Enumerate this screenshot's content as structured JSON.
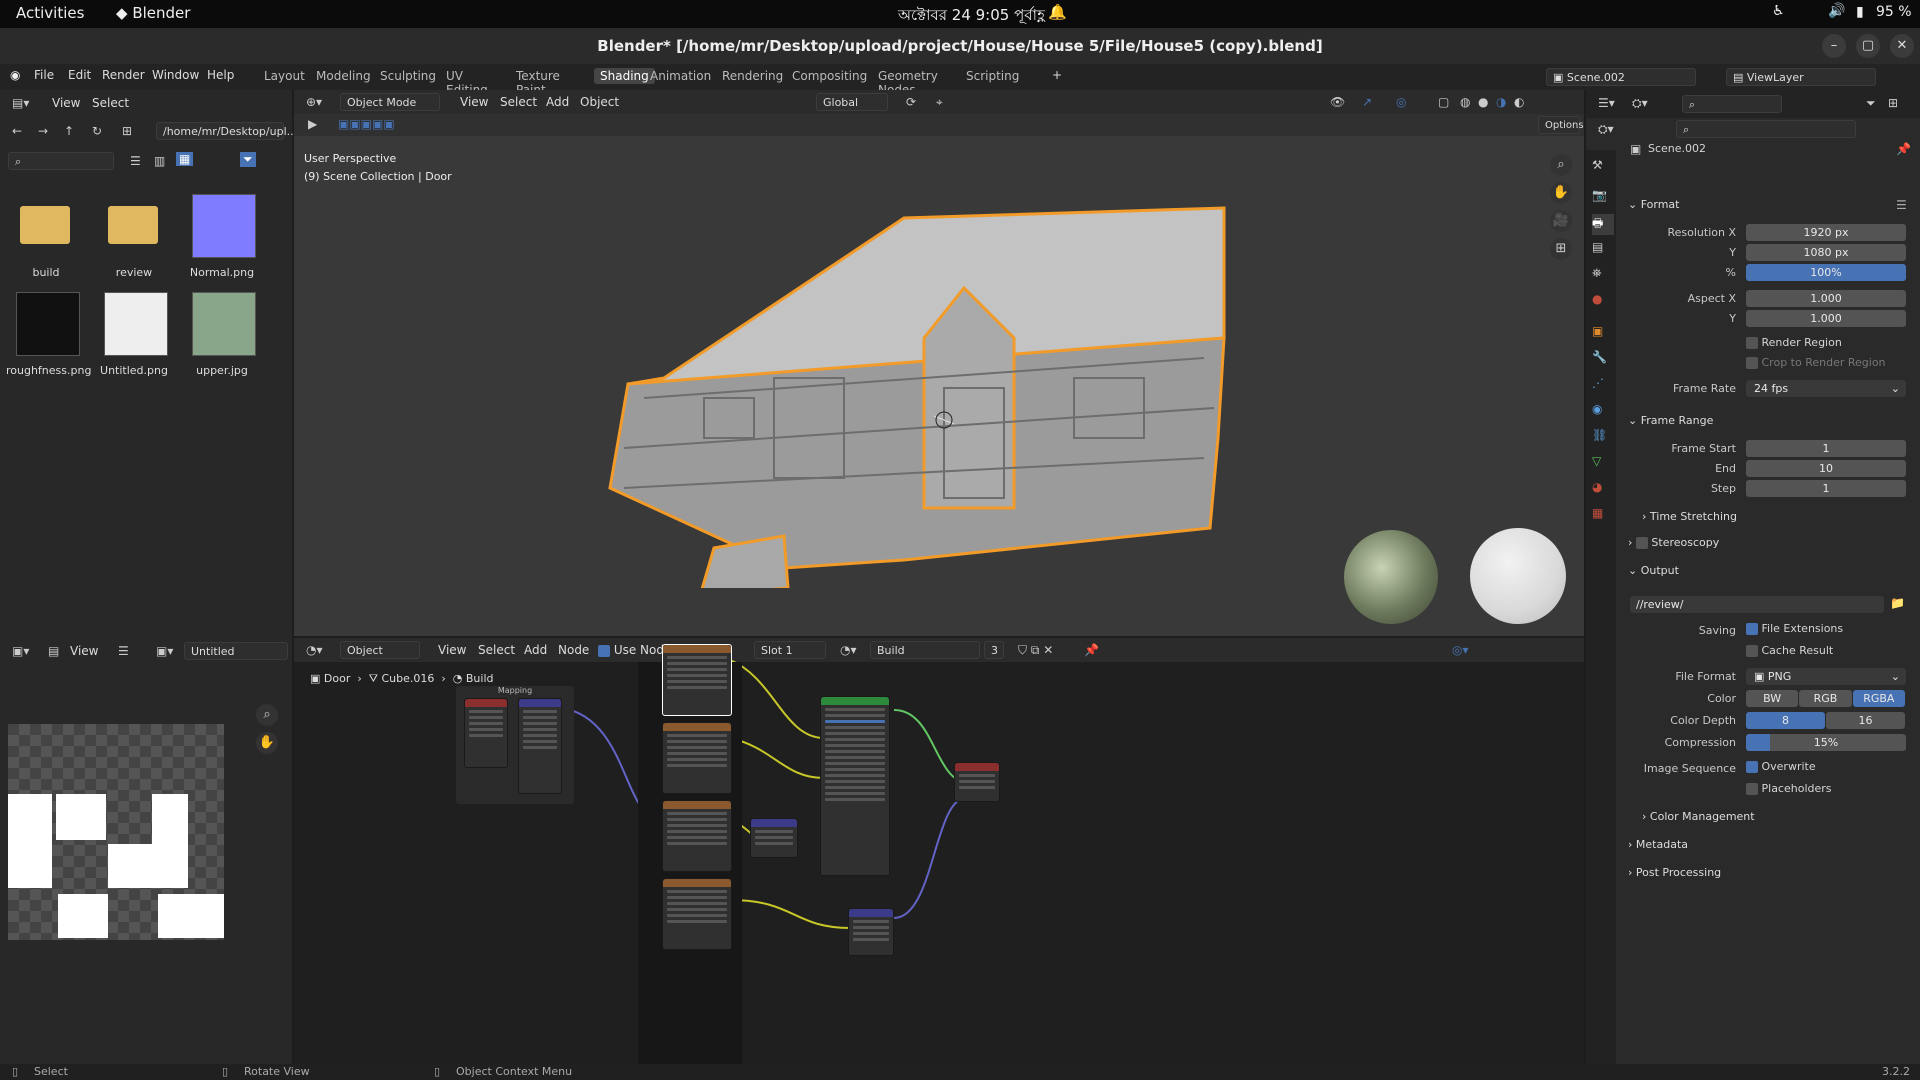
{
  "system_bar": {
    "activities": "Activities",
    "app": "Blender",
    "clock": "অক্টোবর 24  9:05 পূর্বাহ্ণ",
    "battery": "95 %"
  },
  "window": {
    "title": "Blender* [/home/mr/Desktop/upload/project/House/House 5/File/House5 (copy).blend]"
  },
  "menu": {
    "file": "File",
    "edit": "Edit",
    "render": "Render",
    "window": "Window",
    "help": "Help"
  },
  "workspaces": [
    "Layout",
    "Modeling",
    "Sculpting",
    "UV Editing",
    "Texture Paint",
    "Shading",
    "Animation",
    "Rendering",
    "Compositing",
    "Geometry Nodes",
    "Scripting"
  ],
  "active_workspace": "Shading",
  "scene_selector": "Scene.002",
  "view_layer": "ViewLayer",
  "file_browser": {
    "view": "View",
    "select": "Select",
    "path": "/home/mr/Desktop/upl...",
    "items": [
      {
        "name": "build",
        "kind": "folder"
      },
      {
        "name": "review",
        "kind": "folder"
      },
      {
        "name": "Normal.png",
        "kind": "image",
        "color": "#7f7cff"
      },
      {
        "name": "roughfness.png",
        "kind": "image",
        "color": "#111111"
      },
      {
        "name": "Untitled.png",
        "kind": "image",
        "color": "#eeeeee"
      },
      {
        "name": "upper.jpg",
        "kind": "image",
        "color": "#8aa68a"
      }
    ]
  },
  "viewport": {
    "mode": "Object Mode",
    "view": "View",
    "select": "Select",
    "add": "Add",
    "object": "Object",
    "orientation": "Global",
    "options": "Options",
    "overlay_line1": "User Perspective",
    "overlay_line2": "(9) Scene Collection | Door",
    "object_outline_color": "#f29b28"
  },
  "image_editor": {
    "view": "View",
    "image_name": "Untitled"
  },
  "node_editor": {
    "object": "Object",
    "view": "View",
    "select": "Select",
    "add": "Add",
    "node": "Node",
    "use_nodes": "Use Nodes",
    "slot": "Slot 1",
    "material": "Build",
    "users": "3",
    "breadcrumb": [
      "Door",
      "Cube.016",
      "Build"
    ],
    "frame_label": "Mapping"
  },
  "properties": {
    "scene": "Scene.002",
    "format": {
      "title": "Format",
      "res_x_label": "Resolution X",
      "res_x": "1920 px",
      "res_y_label": "Y",
      "res_y": "1080 px",
      "pct_label": "%",
      "pct": "100%",
      "aspect_x_label": "Aspect X",
      "aspect_x": "1.000",
      "aspect_y_label": "Y",
      "aspect_y": "1.000",
      "render_region": "Render Region",
      "crop": "Crop to Render Region",
      "frame_rate_label": "Frame Rate",
      "frame_rate": "24 fps"
    },
    "frame_range": {
      "title": "Frame Range",
      "start_label": "Frame Start",
      "start": "1",
      "end_label": "End",
      "end": "10",
      "step_label": "Step",
      "step": "1",
      "time_stretching": "Time Stretching"
    },
    "stereoscopy": "Stereoscopy",
    "output": {
      "title": "Output",
      "path": "//review/",
      "saving_label": "Saving",
      "file_extensions": "File Extensions",
      "cache_result": "Cache Result",
      "file_format_label": "File Format",
      "file_format": "PNG",
      "color_label": "Color",
      "color_opts": [
        "BW",
        "RGB",
        "RGBA"
      ],
      "color_selected": "RGBA",
      "depth_label": "Color Depth",
      "depth_opts": [
        "8",
        "16"
      ],
      "depth_selected": "8",
      "compression_label": "Compression",
      "compression": "15%",
      "compression_value": 0.15,
      "img_seq_label": "Image Sequence",
      "overwrite": "Overwrite",
      "placeholders": "Placeholders",
      "color_mgmt": "Color Management"
    },
    "metadata": "Metadata",
    "post_processing": "Post Processing"
  },
  "status": {
    "select": "Select",
    "rotate": "Rotate View",
    "context": "Object Context Menu",
    "version": "3.2.2"
  }
}
